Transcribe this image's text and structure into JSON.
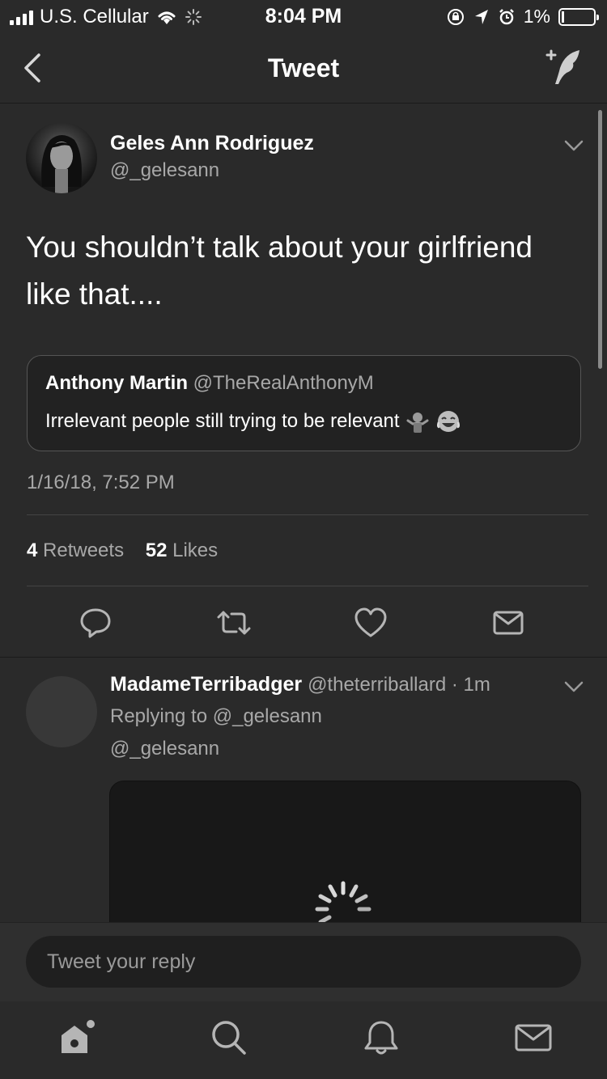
{
  "status_bar": {
    "carrier": "U.S. Cellular",
    "time": "8:04 PM",
    "battery_percent": "1%"
  },
  "nav": {
    "title": "Tweet"
  },
  "tweet": {
    "author_name": "Geles Ann Rodriguez",
    "author_handle": "@_gelesann",
    "text": "You shouldn’t talk about your girlfriend like that....",
    "quote": {
      "author_name": "Anthony Martin",
      "author_handle": "@TheRealAnthonyM",
      "text": "Irrelevant people still trying to be relevant"
    },
    "timestamp": "1/16/18, 7:52 PM",
    "retweet_count": "4",
    "retweet_label": "Retweets",
    "like_count": "52",
    "like_label": "Likes"
  },
  "reply": {
    "author_name": "MadameTerribadger",
    "author_handle": "@theterriballard",
    "time_ago": "1m",
    "replying_to": "Replying to @_gelesann",
    "text": "@_gelesann"
  },
  "composer": {
    "placeholder": "Tweet your reply"
  },
  "icons": {
    "back": "chevron-left-icon",
    "compose": "compose-tweet-icon",
    "reply": "reply-icon",
    "retweet": "retweet-icon",
    "like": "heart-icon",
    "dm": "envelope-icon",
    "home": "home-icon",
    "search": "search-icon",
    "notifications": "bell-icon",
    "messages": "envelope-icon"
  },
  "colors": {
    "background": "#2a2a2a",
    "text": "#ffffff",
    "secondary_text": "#a8a8a8"
  }
}
